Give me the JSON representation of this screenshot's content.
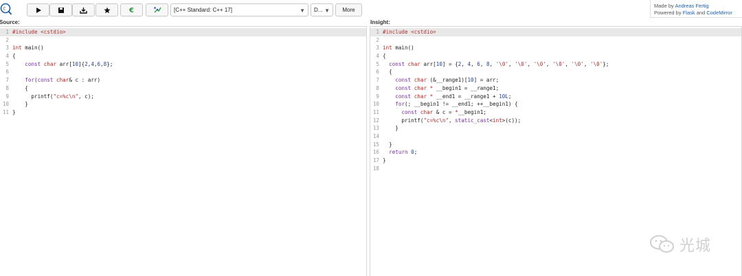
{
  "toolbar": {
    "run_icon": "play-icon",
    "save_icon": "save-icon",
    "download_icon": "download-icon",
    "favorite_icon": "star-icon",
    "cppinsights_icon": "cpp-insights-icon",
    "compiler_explorer_icon": "compiler-explorer-icon",
    "standard_select": "[C++ Standard: C++ 17]",
    "options_select": "D...",
    "more_label": "More"
  },
  "credits": {
    "made_by_prefix": "Made by ",
    "author": "Andreas Fertig",
    "powered_by_prefix": "Powered by ",
    "flask": "Flask",
    "and_text": " and ",
    "codemirror": "CodeMirror"
  },
  "source": {
    "label": "Source:",
    "lines": [
      {
        "num": "1",
        "text": "#include <cstdio>"
      },
      {
        "num": "2",
        "text": ""
      },
      {
        "num": "3",
        "text": "int main()"
      },
      {
        "num": "4",
        "text": "{"
      },
      {
        "num": "5",
        "text": "    const char arr[10]{2,4,6,8};"
      },
      {
        "num": "6",
        "text": ""
      },
      {
        "num": "7",
        "text": "    for(const char& c : arr)"
      },
      {
        "num": "8",
        "text": "    {"
      },
      {
        "num": "9",
        "text": "      printf(\"c=%c\\n\", c);"
      },
      {
        "num": "10",
        "text": "    }"
      },
      {
        "num": "11",
        "text": "}"
      }
    ]
  },
  "insight": {
    "label": "Insight:",
    "lines": [
      {
        "num": "1",
        "text": "#include <cstdio>"
      },
      {
        "num": "2",
        "text": ""
      },
      {
        "num": "3",
        "text": "int main()"
      },
      {
        "num": "4",
        "text": "{"
      },
      {
        "num": "5",
        "text": "  const char arr[10] = {2, 4, 6, 8, '\\0', '\\0', '\\0', '\\0', '\\0', '\\0'};"
      },
      {
        "num": "6",
        "text": "  {"
      },
      {
        "num": "7",
        "text": "    const char (&__range1)[10] = arr;"
      },
      {
        "num": "8",
        "text": "    const char * __begin1 = __range1;"
      },
      {
        "num": "9",
        "text": "    const char * __end1 = __range1 + 10L;"
      },
      {
        "num": "10",
        "text": "    for(; __begin1 != __end1; ++__begin1) {"
      },
      {
        "num": "11",
        "text": "      const char & c = *__begin1;"
      },
      {
        "num": "12",
        "text": "      printf(\"c=%c\\n\", static_cast<int>(c));"
      },
      {
        "num": "13",
        "text": "    }"
      },
      {
        "num": "14",
        "text": ""
      },
      {
        "num": "15",
        "text": "  }"
      },
      {
        "num": "16",
        "text": "  return 0;"
      },
      {
        "num": "17",
        "text": "}"
      },
      {
        "num": "18",
        "text": ""
      }
    ]
  },
  "watermark": {
    "text": "光城",
    "icon": "wechat-icon"
  },
  "colors": {
    "keyword": "#7a2bb0",
    "type": "#c0221a",
    "number": "#1f3fa8",
    "string": "#b03030",
    "link": "#1a5fb4",
    "active_line": "#e8e8e8"
  }
}
